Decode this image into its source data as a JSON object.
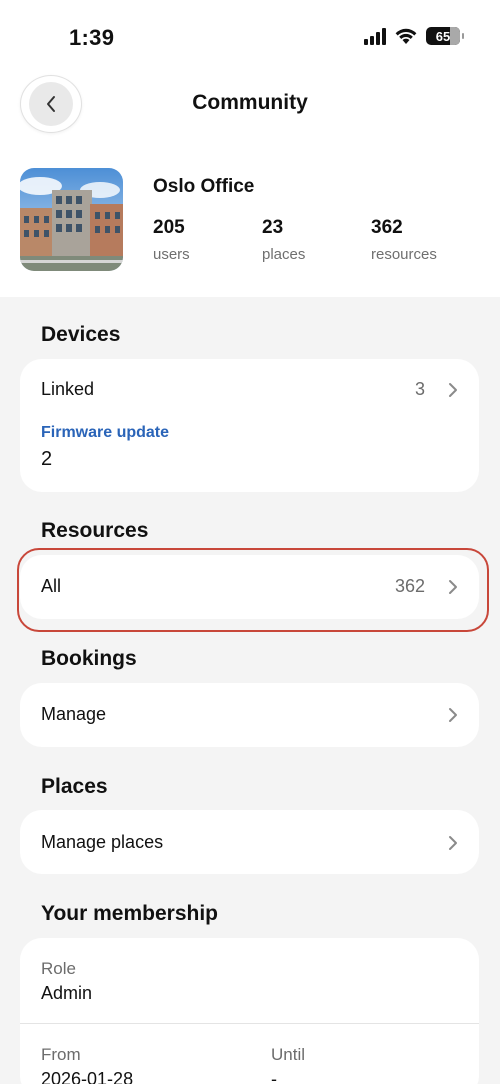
{
  "status_bar": {
    "time": "1:39",
    "battery": "65"
  },
  "header": {
    "title": "Community"
  },
  "community": {
    "name": "Oslo Office",
    "stats": [
      {
        "value": "205",
        "label": "users"
      },
      {
        "value": "23",
        "label": "places"
      },
      {
        "value": "362",
        "label": "resources"
      }
    ]
  },
  "devices": {
    "title": "Devices",
    "linked_label": "Linked",
    "linked_count": "3",
    "firmware_label": "Firmware update",
    "firmware_value": "2"
  },
  "resources": {
    "title": "Resources",
    "all_label": "All",
    "all_count": "362"
  },
  "bookings": {
    "title": "Bookings",
    "manage_label": "Manage"
  },
  "places": {
    "title": "Places",
    "manage_label": "Manage places"
  },
  "membership": {
    "title": "Your membership",
    "role_label": "Role",
    "role_value": "Admin",
    "from_label": "From",
    "from_value": "2026-01-28",
    "until_label": "Until",
    "until_value": "-"
  },
  "colors": {
    "accent_link": "#2a64b8",
    "highlight": "#c8473a",
    "background": "#f4f4f4"
  }
}
